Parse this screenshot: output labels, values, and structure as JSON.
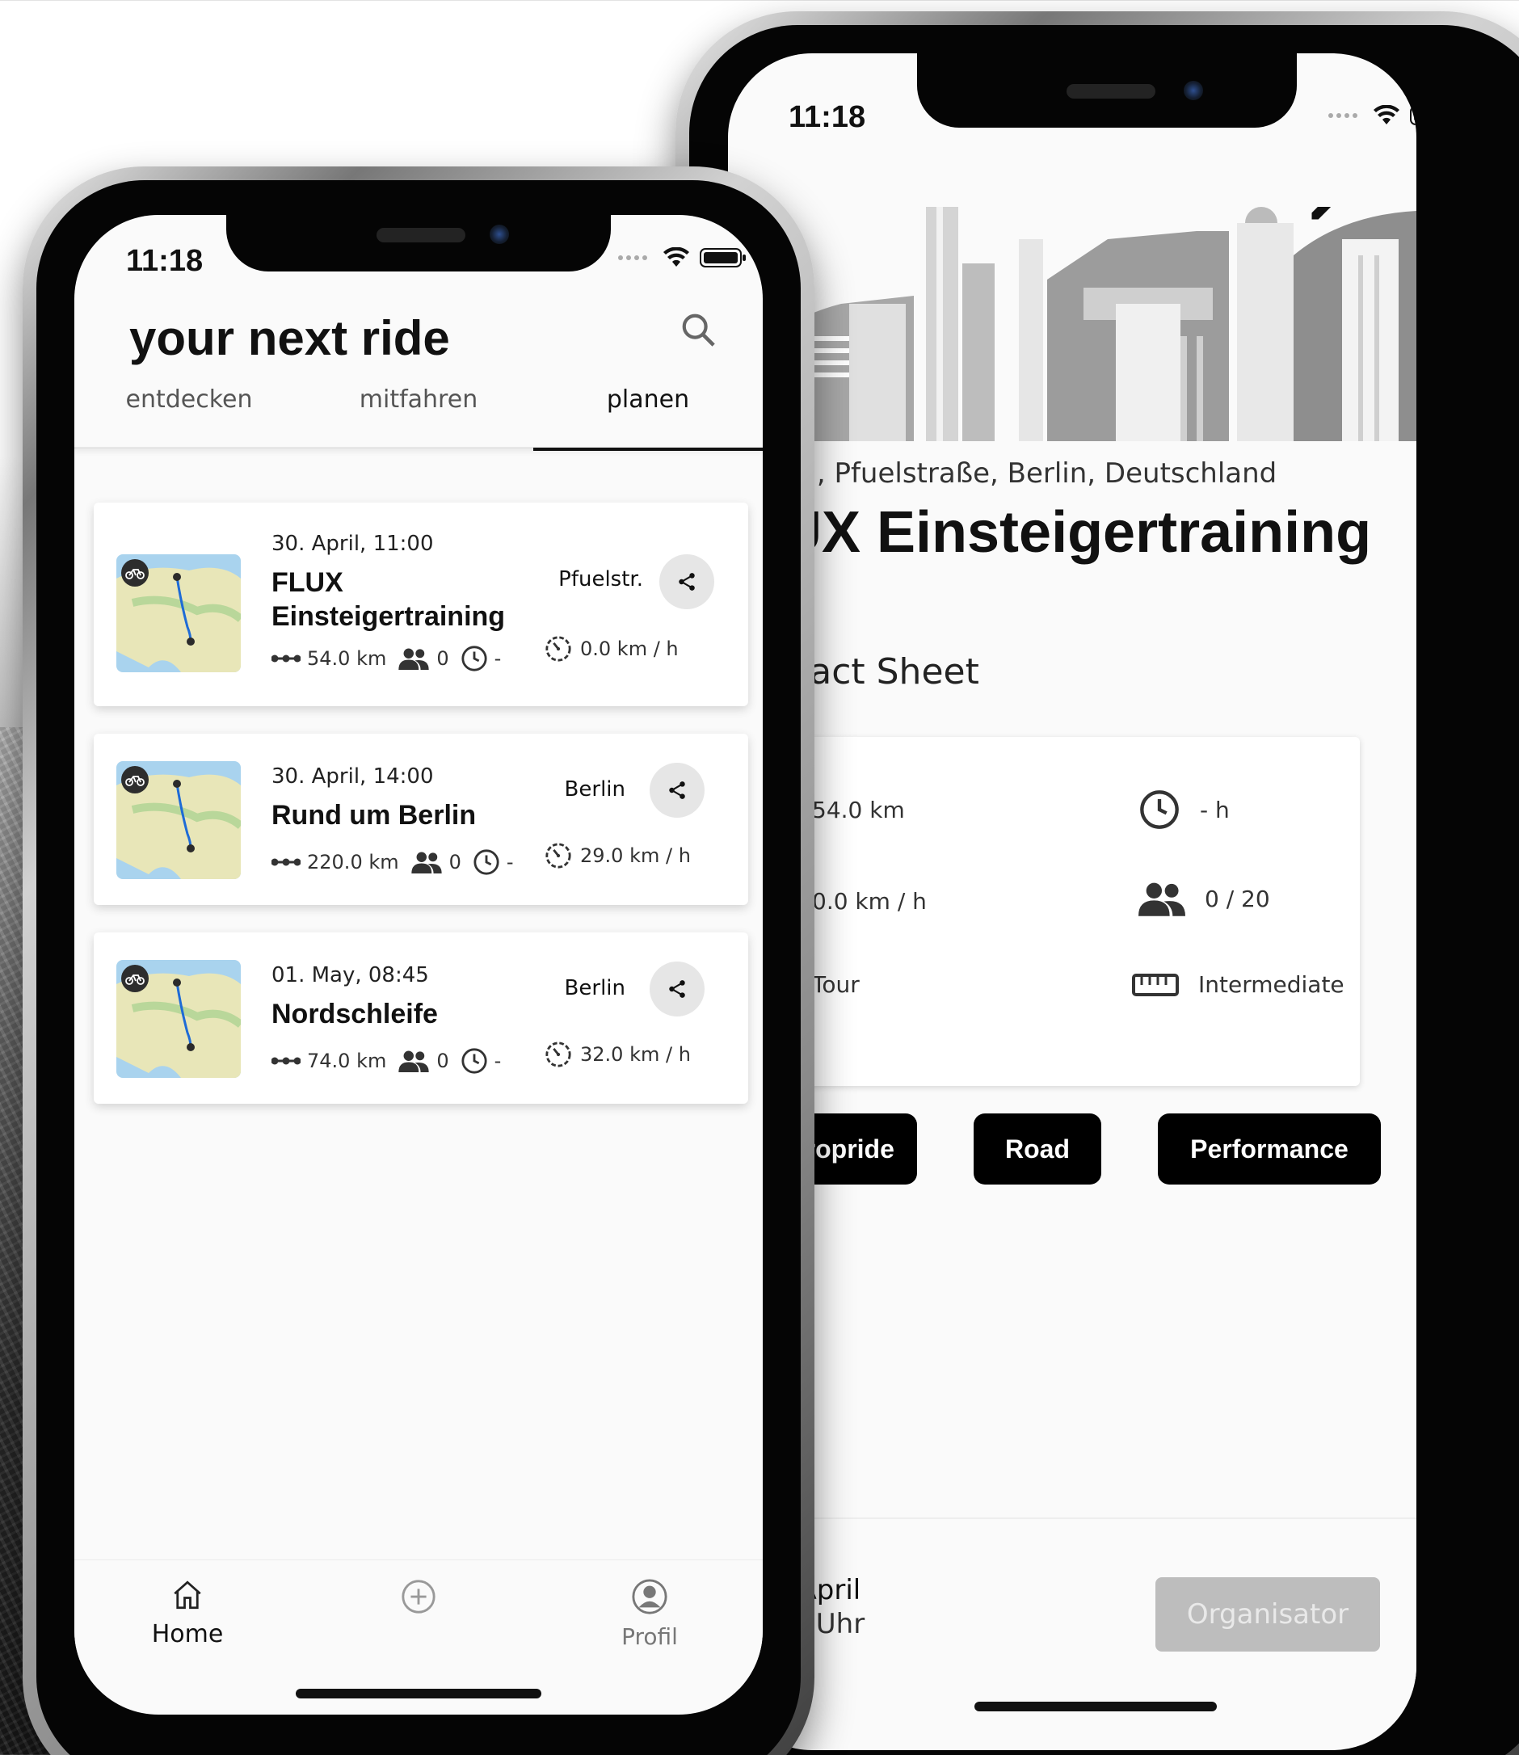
{
  "front": {
    "status_time": "11:18",
    "title": "your next ride",
    "tabs": [
      {
        "label": "entdecken"
      },
      {
        "label": "mitfahren"
      },
      {
        "label": "planen",
        "active": true
      }
    ],
    "rides": [
      {
        "date": "30. April, 11:00",
        "name": "FLUX Einsteigertraining",
        "place": "Pfuelstr.",
        "distance": "54.0 km",
        "participants": "0",
        "duration": "-",
        "speed": "0.0 km / h"
      },
      {
        "date": "30. April, 14:00",
        "name": "Rund um Berlin",
        "place": "Berlin",
        "distance": "220.0 km",
        "participants": "0",
        "duration": "-",
        "speed": "29.0 km / h"
      },
      {
        "date": "01. May, 08:45",
        "name": "Nordschleife",
        "place": "Berlin",
        "distance": "74.0 km",
        "participants": "0",
        "duration": "-",
        "speed": "32.0 km / h"
      }
    ],
    "nav": {
      "home": "Home",
      "profile": "Profil"
    }
  },
  "back": {
    "status_time": "11:18",
    "location": "xBau, Pfuelstraße, Berlin, Deutschland",
    "event_title": "LUX Einsteigertraining",
    "fact_sheet_heading": "ur Fact Sheet",
    "facts": {
      "distance": "54.0 km",
      "duration": "- h",
      "speed": "0.0 km / h",
      "participants": "0 / 20",
      "type": "Tour",
      "level": "Intermediate"
    },
    "tags": [
      "londropride",
      "Road",
      "Performance"
    ],
    "footer": {
      "date": ". 30. April",
      "time": "11:00 Uhr",
      "button": "Organisator"
    }
  },
  "colors": {
    "accent": "#000000",
    "route": "#1e6bd6",
    "disabled_button": "#bdbdbd"
  }
}
